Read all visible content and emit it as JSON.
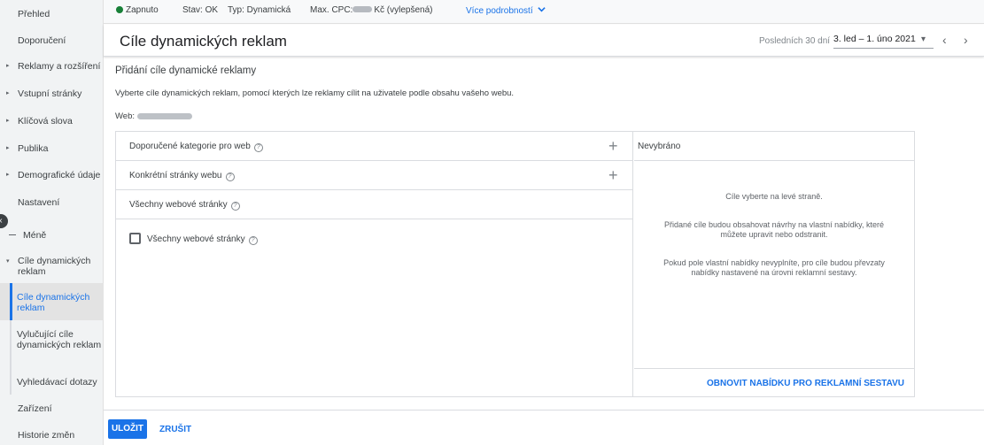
{
  "sidebar": {
    "items": [
      {
        "label": "Přehled",
        "arrow": ""
      },
      {
        "label": "Doporučení",
        "arrow": ""
      },
      {
        "label": "Reklamy a rozšíření",
        "arrow": "▸"
      },
      {
        "label": "Vstupní stránky",
        "arrow": "▸"
      },
      {
        "label": "Klíčová slova",
        "arrow": "▸"
      },
      {
        "label": "Publika",
        "arrow": "▸"
      },
      {
        "label": "Demografické údaje",
        "arrow": "▸"
      },
      {
        "label": "Nastavení",
        "arrow": ""
      }
    ],
    "less_label": "Méně",
    "group_label": "Cíle dynamických reklam",
    "group_arrow": "▾",
    "subitems": [
      {
        "label": "Cíle dynamických reklam",
        "selected": true
      },
      {
        "label": "Vylučující cíle dynamických reklam",
        "selected": false
      },
      {
        "label": "Vyhledávací dotazy",
        "selected": false
      }
    ],
    "bottom_items": [
      {
        "label": "Zařízení"
      },
      {
        "label": "Historie změn"
      }
    ]
  },
  "status_bar": {
    "status": "Zapnuto",
    "status_color": "#188038",
    "state": "Stav: OK",
    "type": "Typ: Dynamická",
    "max_cpc_prefix": "Max. CPC:",
    "max_cpc_suffix": "Kč (vylepšená)",
    "more_details": "Více podrobností"
  },
  "header": {
    "title": "Cíle dynamických reklam",
    "date_range_label": "Posledních 30 dní",
    "date_range_value": "3. led – 1. úno 2021"
  },
  "main": {
    "section_title": "Přidání cíle dynamické reklamy",
    "description": "Vyberte cíle dynamických reklam, pomocí kterých lze reklamy cílit na uživatele podle obsahu vašeho webu.",
    "web_label": "Web:",
    "left_rows": [
      {
        "label": "Doporučené kategorie pro web",
        "has_plus": true
      },
      {
        "label": "Konkrétní stránky webu",
        "has_plus": true
      },
      {
        "label": "Všechny webové stránky",
        "has_plus": false
      }
    ],
    "checkbox_label": "Všechny webové stránky",
    "right_header": "Nevybráno",
    "hints": [
      "Cíle vyberte na levé straně.",
      "Přidané cíle budou obsahovat návrhy na vlastní nabídky, které můžete upravit nebo odstranit.",
      "Pokud pole vlastní nabídky nevyplníte, pro cíle budou převzaty nabídky nastavené na úrovni reklamní sestavy."
    ],
    "right_footer_link": "OBNOVIT NABÍDKU PRO REKLAMNÍ SESTAVU"
  },
  "actions": {
    "save": "ULOŽIT",
    "cancel": "ZRUŠIT"
  },
  "colors": {
    "accent": "#1a73e8"
  }
}
